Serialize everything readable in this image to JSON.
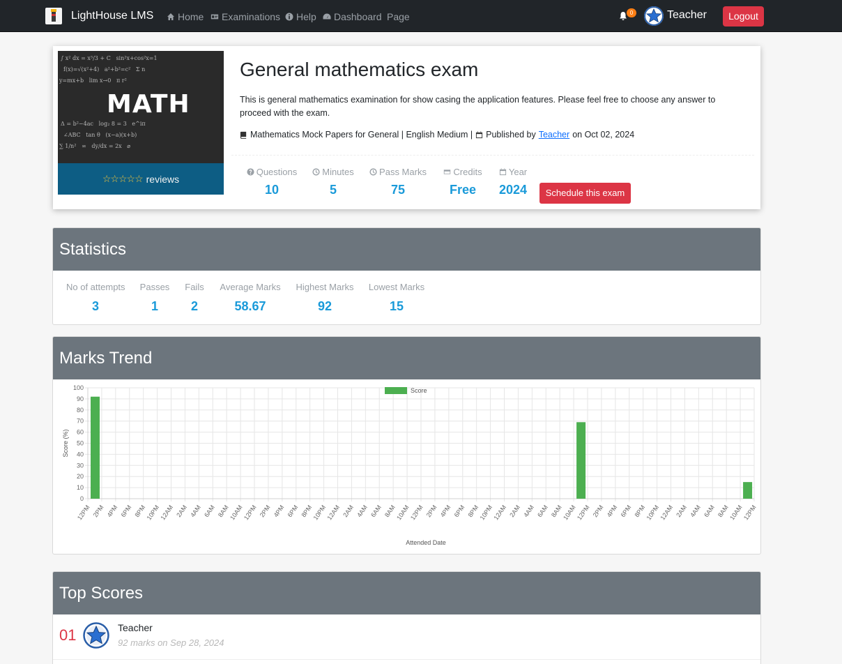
{
  "navbar": {
    "brand": "LightHouse LMS",
    "links": [
      {
        "label": "Home",
        "icon": "home-icon"
      },
      {
        "label": "Examinations",
        "icon": "id-card-icon"
      },
      {
        "label": "Help",
        "icon": "info-circle-icon"
      },
      {
        "label": "Dashboard",
        "icon": "dashboard-icon"
      },
      {
        "label": "Page",
        "icon": ""
      }
    ],
    "notification_count": "0",
    "user_name": "Teacher",
    "logout_label": "Logout"
  },
  "exam": {
    "cover_title": "MATH",
    "reviews_label": "reviews",
    "rating": 0,
    "title": "General mathematics exam",
    "description": "This is general mathematics examination for show casing the application features. Please feel free to choose any answer to proceed with the exam.",
    "category": "Mathematics Mock Papers for General | English Medium |",
    "published_prefix": "Published by",
    "author": "Teacher",
    "published_suffix": "on Oct 02, 2024",
    "stats": {
      "questions_label": "Questions",
      "questions": "10",
      "minutes_label": "Minutes",
      "minutes": "5",
      "pass_label": "Pass Marks",
      "pass": "75",
      "credits_label": "Credits",
      "credits": "Free",
      "year_label": "Year",
      "year": "2024"
    },
    "schedule_label": "Schedule this exam"
  },
  "statistics": {
    "title": "Statistics",
    "items": [
      {
        "label": "No of attempts",
        "value": "3"
      },
      {
        "label": "Passes",
        "value": "1"
      },
      {
        "label": "Fails",
        "value": "2"
      },
      {
        "label": "Average Marks",
        "value": "58.67"
      },
      {
        "label": "Highest Marks",
        "value": "92"
      },
      {
        "label": "Lowest Marks",
        "value": "15"
      }
    ]
  },
  "trend": {
    "title": "Marks Trend"
  },
  "chart_data": {
    "type": "bar",
    "title": "",
    "xlabel": "Attended Date",
    "ylabel": "Score (%)",
    "ylim": [
      0,
      100
    ],
    "yticks": [
      0,
      10,
      20,
      30,
      40,
      50,
      60,
      70,
      80,
      90,
      100
    ],
    "grid": true,
    "legend": "top-center",
    "series": [
      {
        "name": "Score",
        "color": "#4caf50",
        "values": [
          92,
          69,
          15
        ]
      }
    ],
    "categories": [
      "12PM",
      "2PM",
      "4PM",
      "6PM",
      "8PM",
      "10PM",
      "12AM",
      "2AM",
      "4AM",
      "6AM",
      "8AM",
      "10AM",
      "12PM",
      "2PM",
      "4PM",
      "6PM",
      "8PM",
      "10PM",
      "12AM",
      "2AM",
      "4AM",
      "6AM",
      "8AM",
      "10AM",
      "12PM",
      "2PM",
      "4PM",
      "6PM",
      "8PM",
      "10PM",
      "12AM",
      "2AM",
      "4AM",
      "6AM",
      "8AM",
      "10AM",
      "12PM",
      "2PM",
      "4PM",
      "6PM",
      "8PM",
      "10PM",
      "12AM",
      "2AM",
      "4AM",
      "6AM",
      "8AM",
      "10AM",
      "12PM"
    ],
    "bar_category_index": [
      0,
      35,
      47
    ]
  },
  "top_scores": {
    "title": "Top Scores",
    "entries": [
      {
        "rank": "01",
        "name": "Teacher",
        "meta": "92 marks on Sep 28, 2024"
      }
    ]
  }
}
